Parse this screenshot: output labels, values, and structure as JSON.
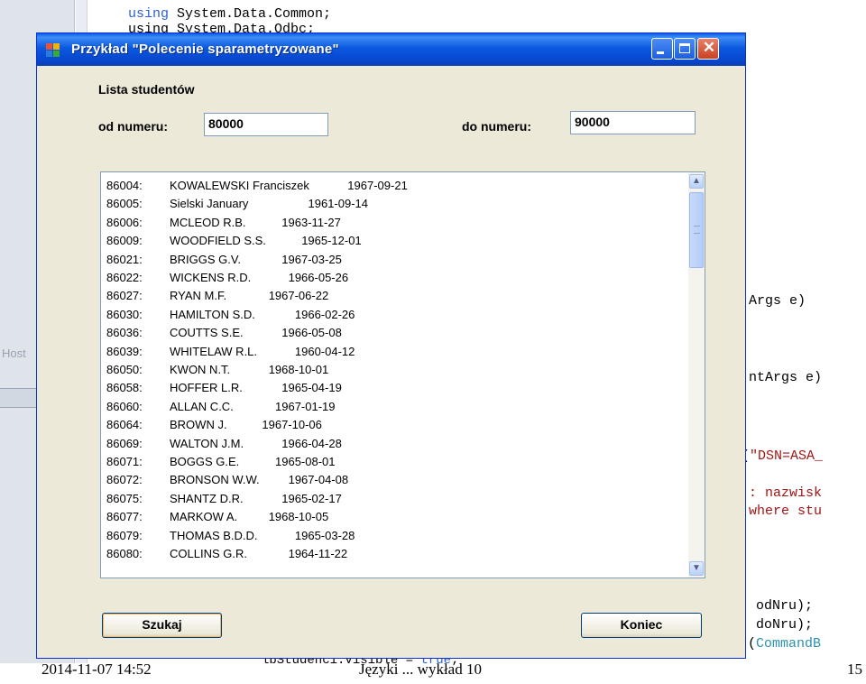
{
  "background_ide": {
    "left_label": "Host",
    "top_code": {
      "kw": "using",
      "rest": " System.Data.Common;"
    },
    "top_code2": "using System.Data.Odbc;",
    "snippets": [
      {
        "kind": "plain",
        "prefix_cls": "",
        "prefix": "",
        "text": "Args e)"
      },
      {
        "kind": "plain",
        "prefix_cls": "",
        "prefix": "",
        "text": "ntArgs e)"
      },
      {
        "kind": "string",
        "prefix": "(",
        "text": "\"DSN=ASA_"
      },
      {
        "kind": "string",
        "prefix": "",
        "text": ": nazwisk"
      },
      {
        "kind": "string",
        "prefix": "",
        "text": "where stu"
      },
      {
        "kind": "plain",
        "prefix": "",
        "text": "odNru);"
      },
      {
        "kind": "plain",
        "prefix": "",
        "text": "doNru);"
      },
      {
        "kind": "cls",
        "prefix": "(",
        "text": "CommandB"
      }
    ],
    "bottom_code": {
      "obj": "lbStudenci.Visible = ",
      "kw": "true",
      "end": ";"
    }
  },
  "window": {
    "title": "Przykład \"Polecenie sparametryzowane\"",
    "colors": {
      "titlebar": "#0b58e0",
      "face": "#ece9d8",
      "close": "#c9421f"
    }
  },
  "form": {
    "list_heading": "Lista studentów",
    "from_label": "od numeru:",
    "from_value": "80000",
    "to_label": "do numeru:",
    "to_value": "90000",
    "search_button": "Szukaj",
    "close_button": "Koniec"
  },
  "students": [
    {
      "id": "86004:",
      "name": "KOWALEWSKI Franciszek",
      "date": "1967-09-21"
    },
    {
      "id": "86005:",
      "name": "Sielski January",
      "date": "1961-09-14"
    },
    {
      "id": "86006:",
      "name": "MCLEOD R.B.",
      "date": "1963-11-27"
    },
    {
      "id": "86009:",
      "name": "WOODFIELD S.S.",
      "date": "1965-12-01"
    },
    {
      "id": "86021:",
      "name": "BRIGGS G.V.",
      "date": "1967-03-25"
    },
    {
      "id": "86022:",
      "name": "WICKENS R.D.",
      "date": "1966-05-26"
    },
    {
      "id": "86027:",
      "name": "RYAN M.F.",
      "date": "1967-06-22"
    },
    {
      "id": "86030:",
      "name": "HAMILTON S.D.",
      "date": "1966-02-26"
    },
    {
      "id": "86036:",
      "name": "COUTTS S.E.",
      "date": "1966-05-08"
    },
    {
      "id": "86039:",
      "name": "WHITELAW R.L.",
      "date": "1960-04-12"
    },
    {
      "id": "86050:",
      "name": "KWON N.T.",
      "date": "1968-10-01"
    },
    {
      "id": "86058:",
      "name": "HOFFER L.R.",
      "date": "1965-04-19"
    },
    {
      "id": "86060:",
      "name": "ALLAN C.C.",
      "date": "1967-01-19"
    },
    {
      "id": "86064:",
      "name": "BROWN J.",
      "date": "1967-10-06"
    },
    {
      "id": "86069:",
      "name": "WALTON J.M.",
      "date": "1966-04-28"
    },
    {
      "id": "86071:",
      "name": "BOGGS G.E.",
      "date": "1965-08-01"
    },
    {
      "id": "86072:",
      "name": "BRONSON W.W.",
      "date": "1967-04-08"
    },
    {
      "id": "86075:",
      "name": "SHANTZ D.R.",
      "date": "1965-02-17"
    },
    {
      "id": "86077:",
      "name": "MARKOW A.",
      "date": "1968-10-05"
    },
    {
      "id": "86079:",
      "name": "THOMAS B.D.D.",
      "date": "1965-03-28"
    },
    {
      "id": "86080:",
      "name": "COLLINS G.R.",
      "date": "1964-11-22"
    }
  ],
  "scrollbar": {
    "up_icon": "scroll-up-arrow",
    "down_icon": "scroll-down-arrow",
    "position": 0.0
  },
  "footer": {
    "datetime": "2014-11-07 14:52",
    "course": "Języki ... wykład 10",
    "page": "15"
  }
}
